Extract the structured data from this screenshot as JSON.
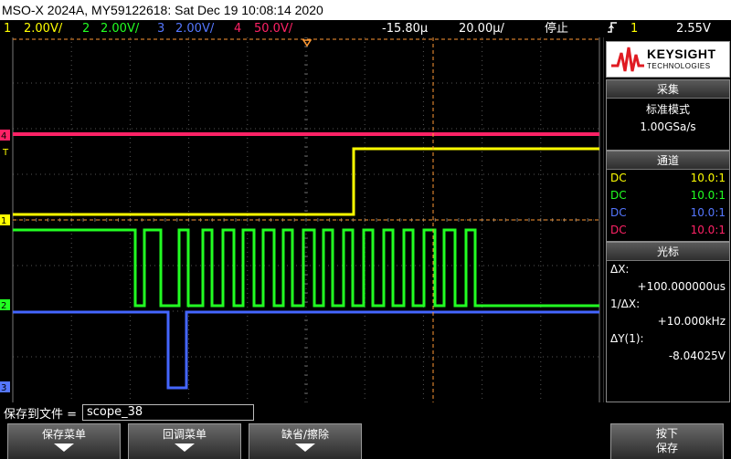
{
  "title": "MSO-X 2024A, MY59122618: Sat Dec 19 10:08:14 2020",
  "status": {
    "ch1": {
      "num": "1",
      "scale": "2.00V/",
      "color": "#ffff00"
    },
    "ch2": {
      "num": "2",
      "scale": "2.00V/",
      "color": "#22ff22"
    },
    "ch3": {
      "num": "3",
      "scale": "2.00V/",
      "color": "#5577ff"
    },
    "ch4": {
      "num": "4",
      "scale": "50.0V/",
      "color": "#ff2266"
    },
    "delay": "-15.80µ",
    "timebase": "20.00µ/",
    "run_state": "停止",
    "trig_icon": "trigger-rising-edge-icon",
    "trig_src": "1",
    "trig_level": "2.55V"
  },
  "markers": {
    "ch4": "4",
    "ch1": "1",
    "ch2": "2",
    "ch3": "3",
    "trig": "T"
  },
  "logo": {
    "brand": "KEYSIGHT",
    "sub": "TECHNOLOGIES"
  },
  "acq": {
    "header": "采集",
    "mode": "标准模式",
    "rate": "1.00GSa/s"
  },
  "channels": {
    "header": "通道",
    "rows": [
      {
        "coupling": "DC",
        "probe": "10.0:1",
        "color": "#ffff00"
      },
      {
        "coupling": "DC",
        "probe": "10.0:1",
        "color": "#22ff22"
      },
      {
        "coupling": "DC",
        "probe": "10.0:1",
        "color": "#5577ff"
      },
      {
        "coupling": "DC",
        "probe": "10.0:1",
        "color": "#ff2266"
      }
    ]
  },
  "cursors": {
    "header": "光标",
    "dx_label": "ΔX:",
    "dx_value": "+100.000000us",
    "inv_label": "1/ΔX:",
    "inv_value": "+10.000kHz",
    "dy_label": "ΔY(1):",
    "dy_value": "-8.04025V"
  },
  "file": {
    "label": "保存到文件 =",
    "name": "scope_38"
  },
  "softkeys": {
    "save_menu": "保存菜单",
    "recall_menu": "回调菜单",
    "default_erase": "缺省/擦除",
    "press_label": "按下",
    "save": "保存"
  }
}
